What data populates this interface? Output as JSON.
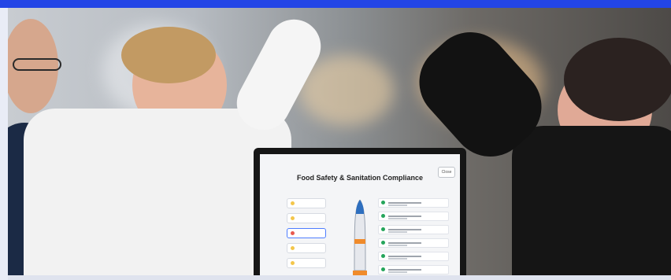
{
  "screen": {
    "title": "Food Safety & Sanitation Compliance",
    "close_label": "Close"
  },
  "colors": {
    "top_band": "#2345e6",
    "task_check": "#25a55b"
  }
}
